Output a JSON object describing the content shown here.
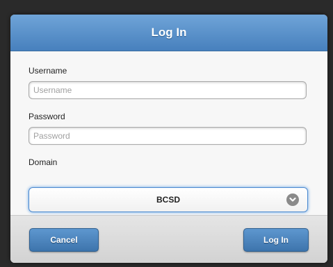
{
  "dialog": {
    "title": "Log In"
  },
  "form": {
    "username_label": "Username",
    "username_placeholder": "Username",
    "password_label": "Password",
    "password_placeholder": "Password",
    "domain_label": "Domain",
    "domain_value": "BCSD"
  },
  "actions": {
    "cancel_label": "Cancel",
    "login_label": "Log In"
  },
  "icons": {
    "domain_dropdown": "chevron-down-icon"
  },
  "colors": {
    "header": "#4f88c4",
    "button": "#4a83bb",
    "focus_glow": "#5d9ee2"
  }
}
